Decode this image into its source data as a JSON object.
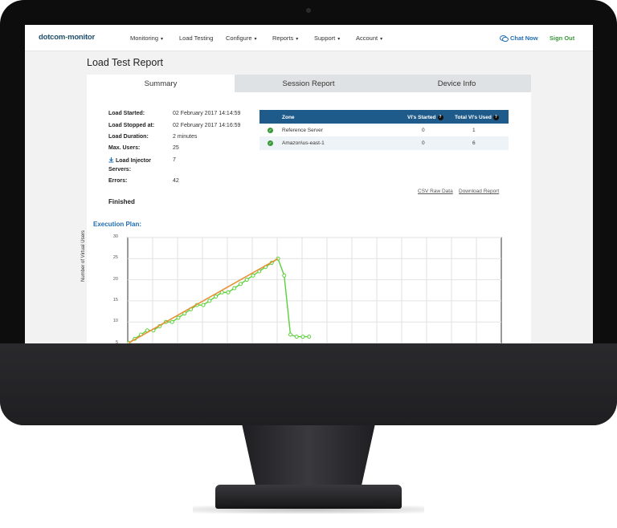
{
  "nav": {
    "logo_part1": "dotcom",
    "logo_dash": "-",
    "logo_part2": "monitor",
    "items": [
      {
        "label": "Monitoring",
        "caret": "▾"
      },
      {
        "label": "Load Testing",
        "caret": ""
      },
      {
        "label": "Configure",
        "caret": "▾"
      },
      {
        "label": "Reports",
        "caret": "▾"
      },
      {
        "label": "Support",
        "caret": "▾"
      },
      {
        "label": "Account",
        "caret": "▾"
      }
    ],
    "chat_label": "Chat Now",
    "signout_label": "Sign Out"
  },
  "page": {
    "title": "Load Test Report"
  },
  "tabs": [
    {
      "label": "Summary",
      "active": true
    },
    {
      "label": "Session Report",
      "active": false
    },
    {
      "label": "Device Info",
      "active": false
    }
  ],
  "summary": {
    "rows": [
      {
        "label": "Load Started:",
        "value": "02 February 2017 14:14:59"
      },
      {
        "label": "Load Stopped at:",
        "value": "02 February 2017 14:16:59"
      },
      {
        "label": "Load Duration:",
        "value": "2 minutes"
      },
      {
        "label": "Max. Users:",
        "value": "25"
      },
      {
        "label": "Load Injector",
        "label2": "Servers:",
        "value": "7"
      },
      {
        "label": "Errors:",
        "value": "42"
      }
    ],
    "status": "Finished"
  },
  "zones": {
    "headers": {
      "zone": "Zone",
      "started": "VI's Started",
      "used": "Total VI's Used"
    },
    "rows": [
      {
        "zone": "Reference Server",
        "started": "0",
        "used": "1"
      },
      {
        "zone": "Amazon\\us-east-1",
        "started": "0",
        "used": "6"
      }
    ]
  },
  "links": {
    "csv": "CSV Raw Data",
    "download": "Download Report"
  },
  "execution_plan": {
    "title": "Execution Plan:"
  },
  "chart_data": {
    "type": "line",
    "ylabel": "Number of Virtual Users",
    "ylim": [
      0,
      30
    ],
    "yticks": [
      30,
      25,
      20,
      15,
      10,
      5
    ],
    "series": [
      {
        "color": "#5ad13a",
        "x": [
          0,
          1,
          2,
          3,
          4,
          5,
          6,
          7,
          8,
          9,
          10,
          11,
          12,
          13,
          14,
          15,
          16,
          17,
          18,
          19,
          20,
          21,
          22,
          23,
          24,
          25,
          26,
          27,
          28,
          29
        ],
        "values": [
          5,
          6,
          7,
          8,
          8,
          9,
          10,
          10,
          11,
          12,
          13,
          14,
          14,
          15,
          16,
          17,
          17,
          18,
          19,
          20,
          21,
          22,
          23,
          24,
          25,
          21,
          7,
          6.5,
          6.5,
          6.5
        ]
      },
      {
        "color": "#e8923a",
        "x": [
          0,
          24
        ],
        "values": [
          5,
          25
        ]
      }
    ]
  },
  "colors": {
    "accent": "#1f5b8a",
    "brand_green": "#3a9a3a",
    "link_blue": "#1f6db3"
  }
}
